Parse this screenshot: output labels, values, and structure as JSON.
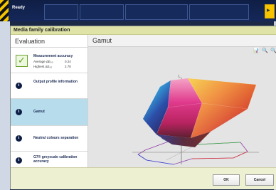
{
  "header": {
    "status": "Ready"
  },
  "dialog": {
    "title": "Media family calibration",
    "left_title": "Evaluation",
    "right_title": "Gamut",
    "accuracy": {
      "title": "Measurement accuracy",
      "rows": [
        {
          "label": "Average ΔE₀₀",
          "value": "0.24"
        },
        {
          "label": "Highest ΔE₀₀",
          "value": "2.70"
        }
      ]
    },
    "items": [
      {
        "label": "Output profile information",
        "selected": false
      },
      {
        "label": "Gamut",
        "selected": true
      },
      {
        "label": "Neutral colours separation",
        "selected": false
      },
      {
        "label": "G7® greyscale calibration accuracy",
        "selected": false
      }
    ],
    "info_glyph": "i",
    "plot_axis_label": "L",
    "buttons": {
      "ok": "OK",
      "cancel": "Cancel"
    },
    "toolbar_icons": [
      "chart-icon",
      "zoom-out-icon",
      "zoom-in-icon"
    ]
  },
  "colors": {
    "title_bg": "#dfe3a8",
    "footer_bg": "#eef0d2",
    "selected_bg": "#b7dcec",
    "header_bg": "#0f1e44",
    "accent": "#f6c400"
  }
}
